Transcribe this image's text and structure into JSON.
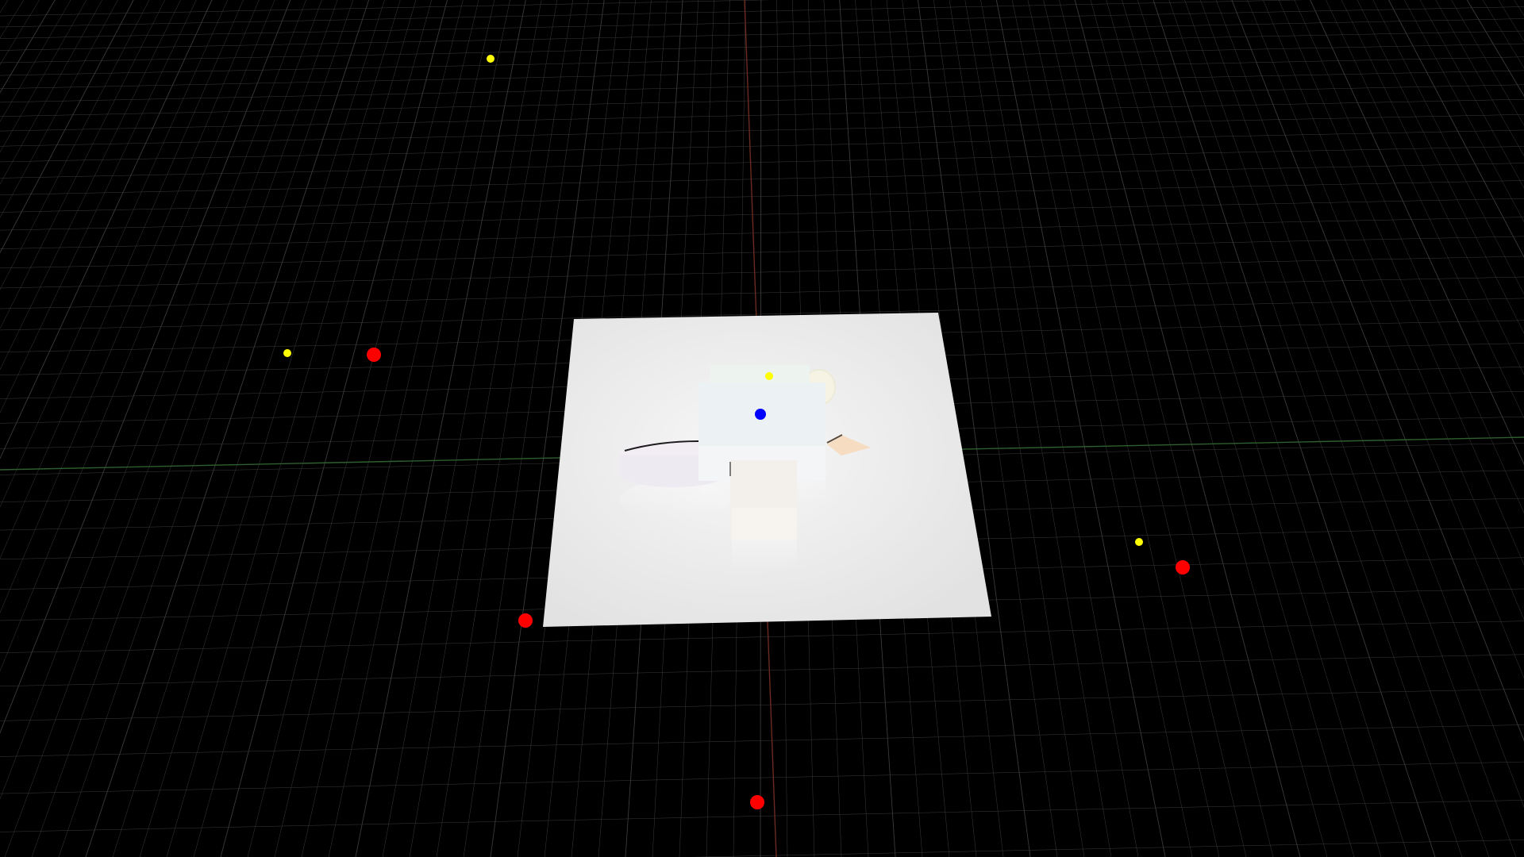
{
  "viewport": {
    "background": "#000000",
    "grid_color": "#3a3a3a",
    "x_axis_color": "#2f5f2f",
    "z_axis_color": "#6b2a22"
  },
  "ground_plane": {
    "color": "#e9e9e9"
  },
  "scene_objects": [
    {
      "name": "back-box",
      "color": "#f2f5f2"
    },
    {
      "name": "main-box",
      "color": "#eef1f3"
    },
    {
      "name": "front-box",
      "color": "#f3efeb"
    },
    {
      "name": "cylinder",
      "color": "#f2eef4"
    },
    {
      "name": "sphere",
      "color": "#f4f2e8"
    },
    {
      "name": "wedge",
      "color": "#f6dcc0"
    }
  ],
  "markers": {
    "light_color": "#ffff00",
    "camera_color": "#ff0000",
    "target_color": "#0000ff"
  }
}
